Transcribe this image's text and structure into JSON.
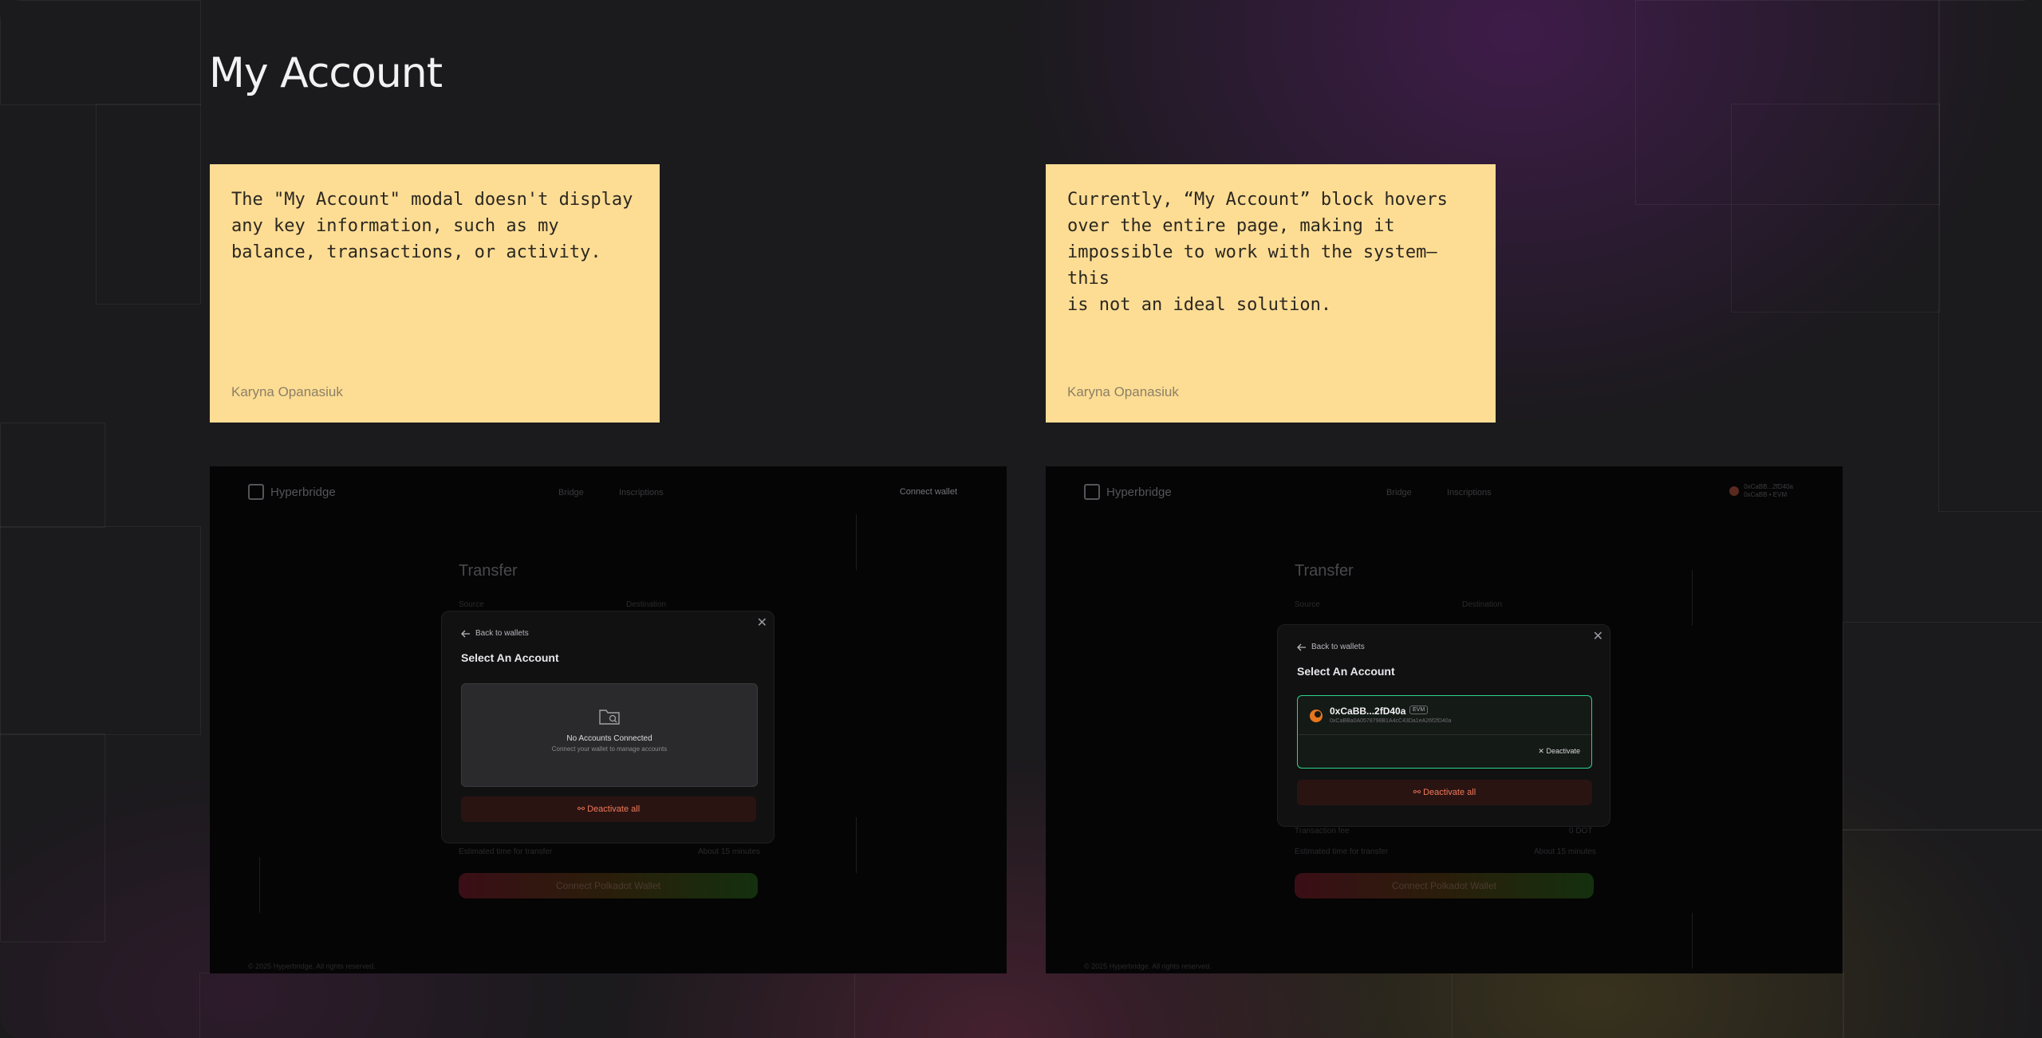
{
  "page": {
    "title": "My Account"
  },
  "notes": [
    {
      "text": "The \"My Account\" modal doesn't display\nany key information, such as my\nbalance, transactions, or activity.",
      "author": "Karyna Opanasiuk"
    },
    {
      "text": "Currently, “My Account” block hovers\nover the entire page, making it\nimpossible to work with the system—this\nis not an ideal solution.",
      "author": "Karyna Opanasiuk"
    }
  ],
  "screens": [
    {
      "brand": "Hyperbridge",
      "nav": [
        "Bridge",
        "Inscriptions"
      ],
      "nav_right": "Connect wallet",
      "transfer_title": "Transfer",
      "ghost": {
        "source": "Source",
        "destination": "Destination",
        "estimated_time": "Estimated time for transfer",
        "estimated_value": "About 15 minutes",
        "connect_button": "Connect Polkadot Wallet",
        "footer": "© 2025 Hyperbridge. All rights reserved."
      },
      "modal": {
        "close": "✕",
        "back": "Back to wallets",
        "heading": "Select An Account",
        "empty_title": "No Accounts Connected",
        "empty_subtitle": "Connect your wallet to manage accounts",
        "deactivate_all": "Deactivate all"
      }
    },
    {
      "brand": "Hyperbridge",
      "nav": [
        "Bridge",
        "Inscriptions"
      ],
      "wallet_chip": {
        "address": "0xCaBB...2fD40a",
        "sub": "0xCaBB • EVM"
      },
      "transfer_title": "Transfer",
      "ghost": {
        "source": "Source",
        "destination": "Destination",
        "transaction_fee": "Transaction fee",
        "transaction_fee_value": "0 DOT",
        "estimated_time": "Estimated time for transfer",
        "estimated_value": "About 15 minutes",
        "connect_button": "Connect Polkadot Wallet",
        "footer": "© 2025 Hyperbridge. All rights reserved."
      },
      "modal": {
        "close": "✕",
        "back": "Back to wallets",
        "heading": "Select An Account",
        "account_name": "0xCaBB...2fD40a",
        "account_badge": "EVM",
        "account_full": "0xCaBBa0A0578798B1A4cC43Da1eA26f2fD40a",
        "deactivate": "Deactivate",
        "deactivate_all": "Deactivate all"
      }
    }
  ],
  "colors": {
    "note_bg": "#fddd94",
    "accent_green": "#2bd48a",
    "danger": "#f07a5a"
  }
}
